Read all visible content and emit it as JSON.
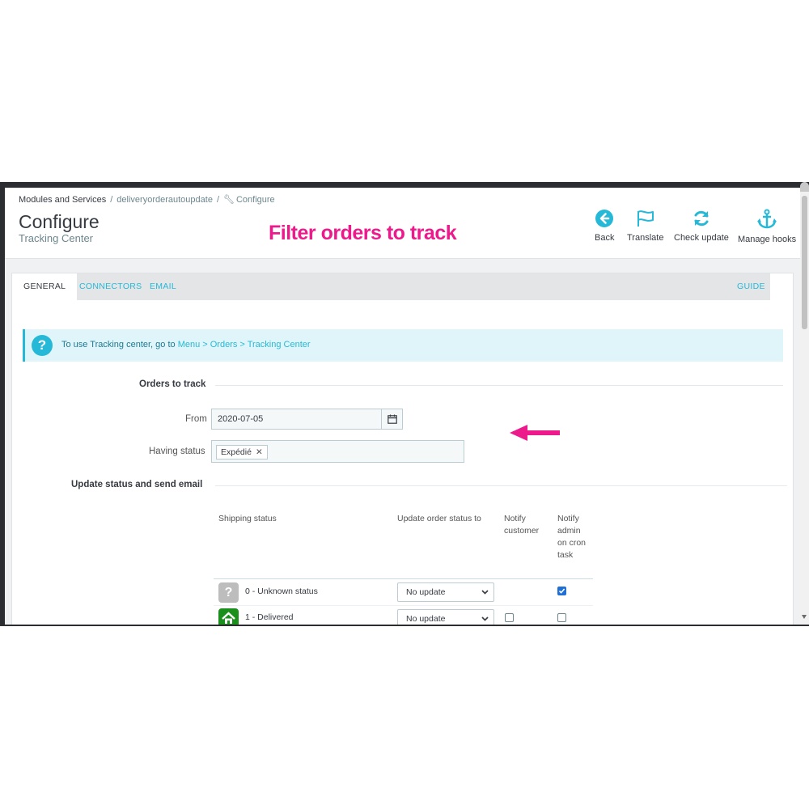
{
  "breadcrumb": {
    "items": [
      "Modules and Services",
      "deliveryorderautoupdate",
      "Configure"
    ]
  },
  "page": {
    "title": "Configure",
    "subtitle": "Tracking Center"
  },
  "annotation": {
    "title": "Filter orders to track",
    "color": "#ec1a8a"
  },
  "toolbar": {
    "back_label": "Back",
    "translate_label": "Translate",
    "check_update_label": "Check update",
    "manage_hooks_label": "Manage hooks",
    "icon_color": "#25b9d7"
  },
  "tabs": [
    {
      "label": "GENERAL",
      "active": true
    },
    {
      "label": "CONNECTORS",
      "active": false
    },
    {
      "label": "EMAIL",
      "active": false
    },
    {
      "label": "GUIDE",
      "active": false
    }
  ],
  "alert": {
    "text_prefix": "To use Tracking center, go to",
    "link_text": "Menu > Orders > Tracking Center"
  },
  "orders_to_track": {
    "section_title": "Orders to track",
    "from_label": "From",
    "from_value": "2020-07-05",
    "having_status_label": "Having status",
    "status_tags": [
      "Expédié"
    ]
  },
  "update_section": {
    "section_title": "Update status and send email",
    "columns": {
      "shipping_status": "Shipping status",
      "update_order_status_to": "Update order status to",
      "notify_customer": "Notify customer",
      "notify_admin": "Notify admin on cron task"
    },
    "rows": [
      {
        "icon": "question-icon",
        "name": "0 - Unknown status",
        "update_to": "No update",
        "notify_customer_visible": false,
        "notify_customer": false,
        "notify_admin": true
      },
      {
        "icon": "home-icon",
        "name": "1 - Delivered",
        "update_to": "No update",
        "notify_customer_visible": true,
        "notify_customer": false,
        "notify_admin": false
      }
    ]
  }
}
